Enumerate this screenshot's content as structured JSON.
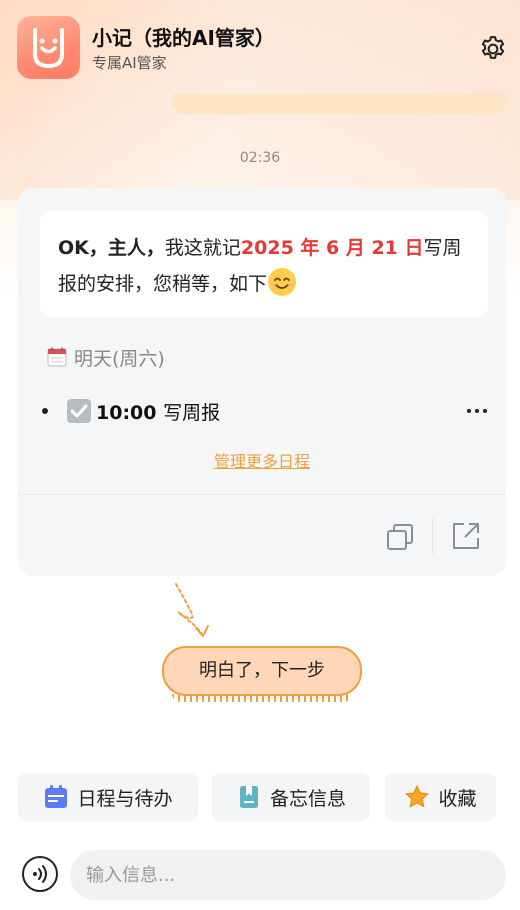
{
  "header": {
    "title": "小记（我的AI管家）",
    "subtitle": "专属AI管家",
    "logo_icon": "smile-face-logo",
    "settings_icon": "gear-icon"
  },
  "chat": {
    "timestamp": "02:36",
    "message": {
      "greeting": "OK，主人，",
      "part1": "我这就记",
      "date": "2025 年 6 月 21 日",
      "part2": "写周报的安排，您稍等，如下"
    },
    "schedule": {
      "day_label": "明天(周六)",
      "items": [
        {
          "time": "10:00",
          "task": "写周报"
        }
      ],
      "manage_link": "管理更多日程"
    }
  },
  "next_step_button": "明白了，下一步",
  "quick_actions": [
    {
      "label": "日程与待办",
      "icon": "calendar-icon",
      "color": "#5b7cf5"
    },
    {
      "label": "备忘信息",
      "icon": "bookmark-icon",
      "color": "#5fb3c4"
    },
    {
      "label": "收藏",
      "icon": "star-icon",
      "color": "#f5a623"
    }
  ],
  "input": {
    "placeholder": "输入信息..."
  },
  "colors": {
    "accent_orange": "#f0a040",
    "date_red": "#e53935",
    "logo_gradient": "#ff8a70"
  }
}
